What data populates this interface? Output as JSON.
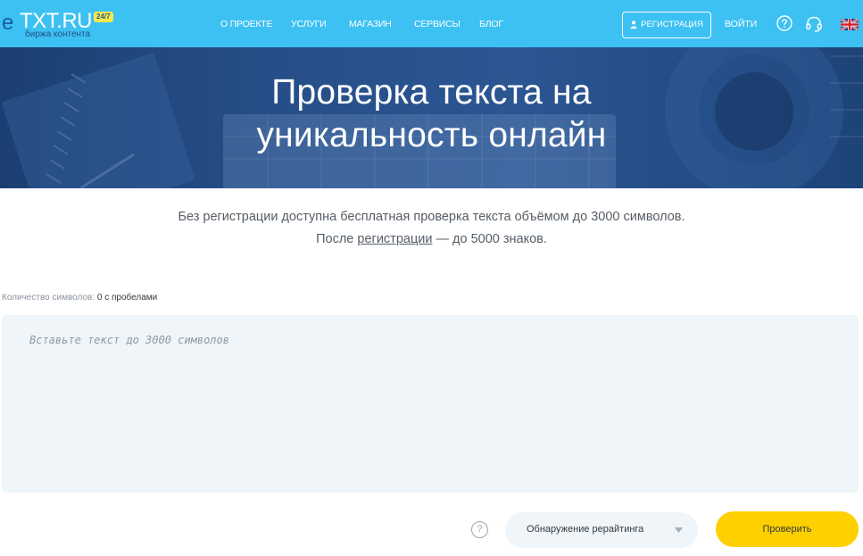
{
  "header": {
    "logo": {
      "mark": "e",
      "text": "TXT.RU",
      "badge": "24/7",
      "subtitle": "биржа контента"
    },
    "nav": [
      {
        "label": "О ПРОЕКТЕ"
      },
      {
        "label": "УСЛУГИ"
      },
      {
        "label": "МАГАЗИН"
      },
      {
        "label": "СЕРВИСЫ"
      },
      {
        "label": "БЛОГ"
      }
    ],
    "register_label": "РЕГИСТРАЦИЯ",
    "login_label": "ВОЙТИ",
    "icons": [
      "help-icon",
      "support-headset-icon",
      "uk-flag-icon"
    ]
  },
  "hero": {
    "title_line1": "Проверка текста на",
    "title_line2": "уникальность онлайн"
  },
  "info": {
    "line1": "Без регистрации доступна бесплатная проверка текста объёмом до 3000 символов.",
    "line2_before": "После ",
    "line2_link": "регистрации",
    "line2_after": " — до 5000 знаков."
  },
  "counter": {
    "label": "Количество символов: ",
    "value": "0 с пробелами"
  },
  "editor": {
    "placeholder": "Вставьте текст до 3000 символов",
    "value": ""
  },
  "controls": {
    "help_mark": "?",
    "mode_selected": "Обнаружение рерайтинга",
    "submit_label": "Проверить"
  },
  "colors": {
    "header_bg": "#3dc1f3",
    "hero_bg": "#27508a",
    "submit_bg": "#ffd000",
    "editor_bg": "#eff5f9"
  }
}
